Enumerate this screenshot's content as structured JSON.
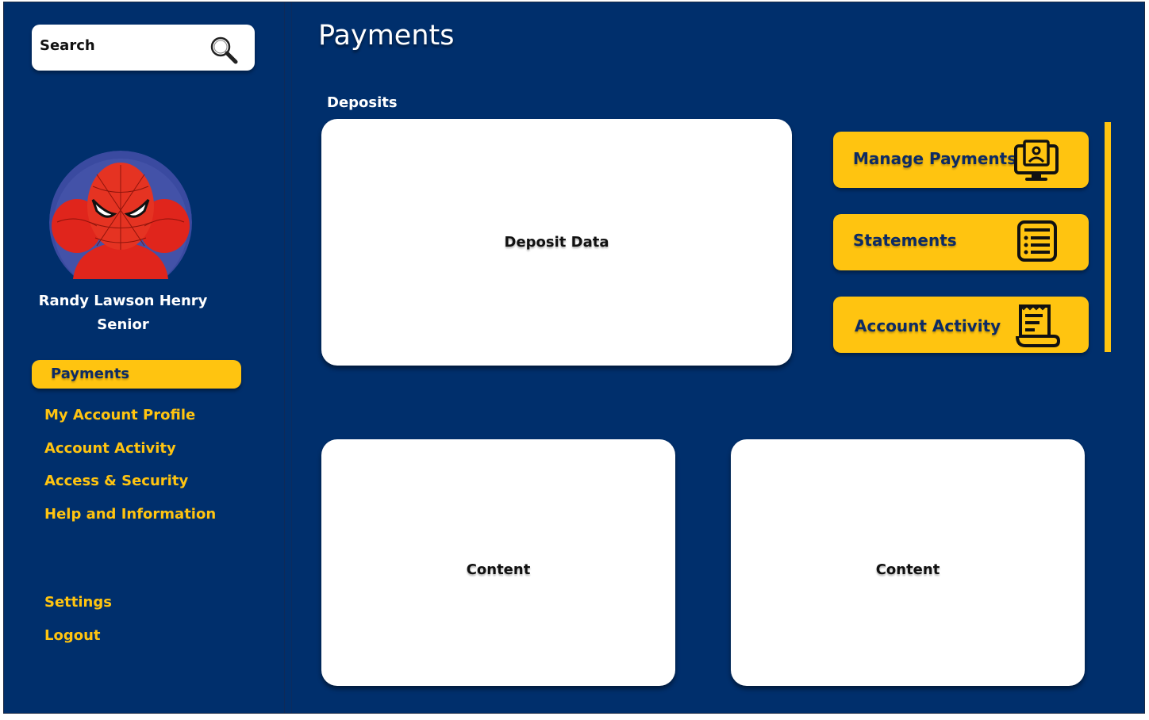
{
  "search": {
    "label": "Search"
  },
  "user": {
    "name": "Randy Lawson Henry",
    "role": "Senior"
  },
  "nav": {
    "active": "Payments",
    "items": [
      "My Account Profile",
      "Account Activity",
      "Access & Security",
      "Help and Information"
    ],
    "bottom": [
      "Settings",
      "Logout"
    ]
  },
  "page": {
    "title": "Payments"
  },
  "deposits": {
    "label": "Deposits",
    "card_text": "Deposit Data"
  },
  "actions": [
    {
      "label": "Manage Payments",
      "icon": "monitor-payment-icon"
    },
    {
      "label": "Statements",
      "icon": "list-document-icon"
    },
    {
      "label": "Account Activity",
      "icon": "scroll-document-icon"
    }
  ],
  "content_cards": [
    "Content",
    "Content"
  ],
  "colors": {
    "background": "#002f6c",
    "accent": "#ffc410",
    "text_dark": "#0d2b64"
  }
}
